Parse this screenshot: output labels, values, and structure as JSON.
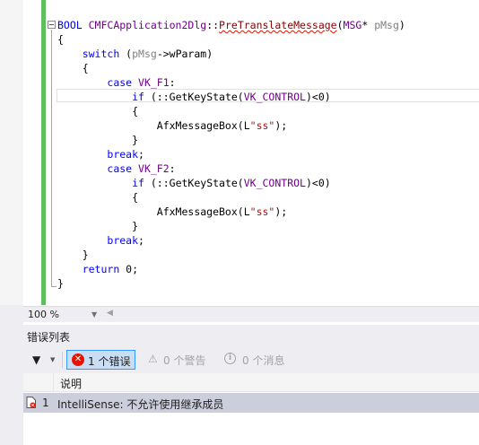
{
  "editor": {
    "lines": [
      [
        {
          "t": "BOOL ",
          "c": "kw"
        },
        {
          "t": "CMFCApplication2Dlg",
          "c": "ty"
        },
        {
          "t": "::"
        },
        {
          "t": "PreTranslateMessage",
          "c": "fn squig"
        },
        {
          "t": "("
        },
        {
          "t": "MSG",
          "c": "ty"
        },
        {
          "t": "* "
        },
        {
          "t": "pMsg",
          "c": "pa"
        },
        {
          "t": ")"
        }
      ],
      [
        {
          "t": "{"
        }
      ],
      [
        {
          "t": "    "
        },
        {
          "t": "switch",
          "c": "kw"
        },
        {
          "t": " ("
        },
        {
          "t": "pMsg",
          "c": "pa"
        },
        {
          "t": "->wParam)"
        }
      ],
      [
        {
          "t": "    {"
        }
      ],
      [
        {
          "t": "        "
        },
        {
          "t": "case",
          "c": "kw"
        },
        {
          "t": " "
        },
        {
          "t": "VK_F1",
          "c": "ty"
        },
        {
          "t": ":"
        }
      ],
      [
        {
          "t": "            "
        },
        {
          "t": "if",
          "c": "kw"
        },
        {
          "t": " (::GetKeyState("
        },
        {
          "t": "VK_CONTROL",
          "c": "ty"
        },
        {
          "t": ")<0)"
        }
      ],
      [
        {
          "t": "            {"
        }
      ],
      [
        {
          "t": "                AfxMessageBox(L"
        },
        {
          "t": "\"ss\"",
          "c": "str"
        },
        {
          "t": ");"
        }
      ],
      [
        {
          "t": "            }"
        }
      ],
      [
        {
          "t": "        "
        },
        {
          "t": "break",
          "c": "kw"
        },
        {
          "t": ";"
        }
      ],
      [
        {
          "t": "        "
        },
        {
          "t": "case",
          "c": "kw"
        },
        {
          "t": " "
        },
        {
          "t": "VK_F2",
          "c": "ty"
        },
        {
          "t": ":"
        }
      ],
      [
        {
          "t": "            "
        },
        {
          "t": "if",
          "c": "kw"
        },
        {
          "t": " (::GetKeyState("
        },
        {
          "t": "VK_CONTROL",
          "c": "ty"
        },
        {
          "t": ")<0)"
        }
      ],
      [
        {
          "t": "            {"
        }
      ],
      [
        {
          "t": "                AfxMessageBox(L"
        },
        {
          "t": "\"ss\"",
          "c": "str"
        },
        {
          "t": ");"
        }
      ],
      [
        {
          "t": "            }"
        }
      ],
      [
        {
          "t": "        "
        },
        {
          "t": "break",
          "c": "kw"
        },
        {
          "t": ";"
        }
      ],
      [
        {
          "t": "    }"
        }
      ],
      [
        {
          "t": "    "
        },
        {
          "t": "return",
          "c": "kw"
        },
        {
          "t": " 0;"
        }
      ],
      [
        {
          "t": "}"
        }
      ]
    ]
  },
  "zoom": {
    "value": "100 %",
    "icon": "chevron-down-icon"
  },
  "error_list": {
    "title": "错误列表",
    "filter_icon": "filter-icon",
    "errors_button": "1 个错误",
    "warnings_button": "0 个警告",
    "messages_button": "0 个消息",
    "columns": {
      "description": "说明"
    },
    "rows": [
      {
        "number": "1",
        "description": "IntelliSense: 不允许使用继承成员",
        "icon": "intellisense-error-icon"
      }
    ]
  },
  "colors": {
    "keyword": "#0000ff",
    "type": "#6f008a",
    "param": "#808080",
    "error": "#e51400",
    "change_bar": "#5fbf5f",
    "selected_row": "#cccedb"
  }
}
